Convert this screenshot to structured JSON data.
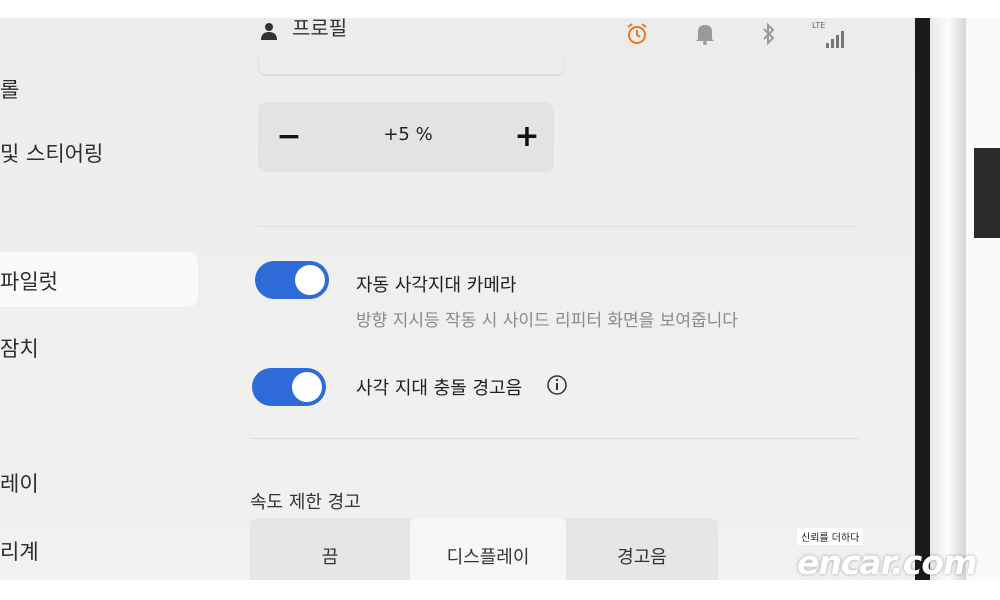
{
  "sidebar": {
    "items": [
      {
        "label": "롤"
      },
      {
        "label": "및 스티어링"
      },
      {
        "label": "파일럿"
      },
      {
        "label": "잠치"
      },
      {
        "label": "레이"
      },
      {
        "label": "리계"
      }
    ]
  },
  "header": {
    "profile_label": "프로필",
    "status_icons": [
      "alarm-icon",
      "bell-icon",
      "bluetooth-icon",
      "lte-signal-icon"
    ],
    "lte_text": "LTE",
    "alarm_color": "#e8772e"
  },
  "offset": {
    "value": "+5 %",
    "minus_label": "−",
    "plus_label": "+"
  },
  "settings": {
    "auto_blindspot_camera": {
      "title": "자동 사각지대 카메라",
      "subtitle": "방향 지시등 작동 시 사이드 리피터 화면을 보여줍니다",
      "enabled": true
    },
    "blindspot_chime": {
      "title": "사각 지대 충돌 경고음",
      "enabled": true
    }
  },
  "speed_limit": {
    "title": "속도 제한 경고",
    "options": [
      "끔",
      "디스플레이",
      "경고음"
    ],
    "selected": "디스플레이"
  },
  "watermark": {
    "tagline": "신뢰를 더하다",
    "brand": "encar.com"
  },
  "colors": {
    "toggle_on": "#2f6ad9",
    "screen_bg": "#eeeeec"
  }
}
